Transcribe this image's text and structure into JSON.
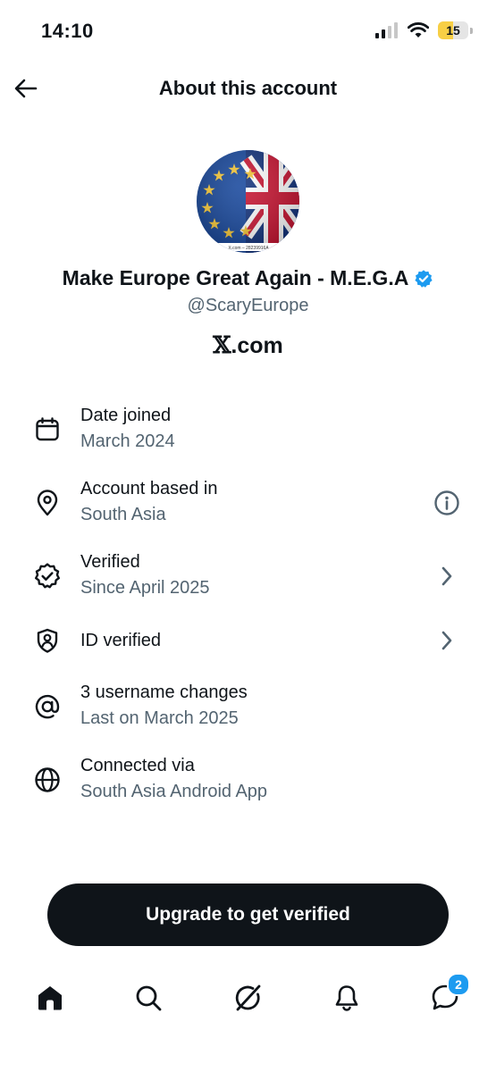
{
  "status_bar": {
    "time": "14:10",
    "battery_level": "15",
    "battery_fill_fraction": 0.5
  },
  "header": {
    "title": "About this account",
    "back_icon": "arrow-left-icon"
  },
  "profile": {
    "display_name": "Make Europe Great Again - M.E.G.A",
    "verified_badge": "verified-badge-icon",
    "handle": "@ScaryEurope",
    "site_x": "𝕏",
    "site_rest": ".com",
    "avatar_watermark": "X.com – 28239916A"
  },
  "info": [
    {
      "icon": "calendar-icon",
      "label": "Date joined",
      "value": "March 2024",
      "trailing": ""
    },
    {
      "icon": "location-pin-icon",
      "label": "Account based in",
      "value": "South Asia",
      "trailing": "info-icon"
    },
    {
      "icon": "verified-check-icon",
      "label": "Verified",
      "value": "Since April 2025",
      "trailing": "chevron-right-icon"
    },
    {
      "icon": "shield-person-icon",
      "label": "ID verified",
      "value": "",
      "trailing": "chevron-right-icon"
    },
    {
      "icon": "at-sign-icon",
      "label": "3 username changes",
      "value": "Last on March 2025",
      "trailing": ""
    },
    {
      "icon": "globe-icon",
      "label": "Connected via",
      "value": "South Asia Android App",
      "trailing": ""
    }
  ],
  "upgrade_button": {
    "label": "Upgrade to get verified"
  },
  "tabbar": {
    "items": [
      "home-icon",
      "search-icon",
      "grok-icon",
      "notifications-bell-icon",
      "messages-icon"
    ],
    "messages_badge": "2"
  },
  "colors": {
    "text": "#0f1419",
    "muted": "#536471",
    "accent": "#1d9bf0",
    "button": "#0f1419"
  }
}
